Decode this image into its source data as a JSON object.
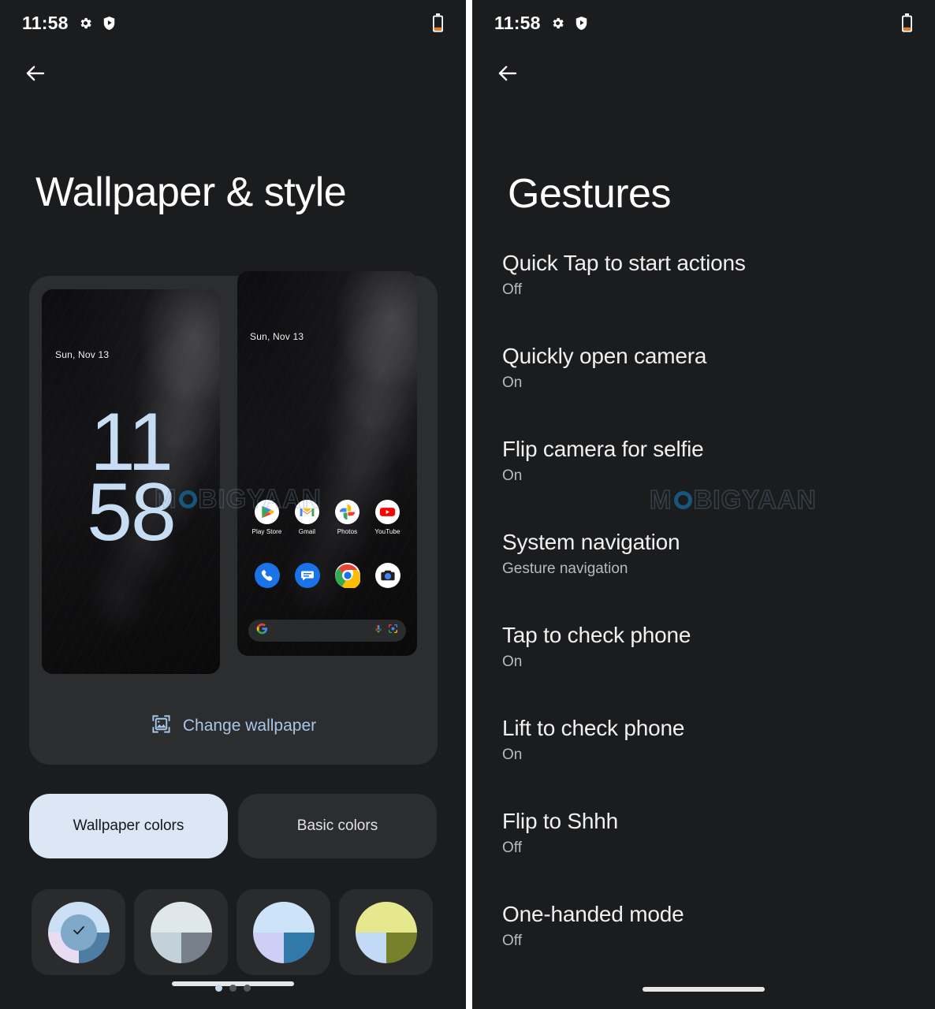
{
  "left_screen": {
    "status_bar": {
      "time": "11:58",
      "icons": [
        "gear-icon",
        "shield-play-icon"
      ],
      "battery": "battery-low-icon"
    },
    "back_label": "back-arrow",
    "title": "Wallpaper & style",
    "preview_card": {
      "lock_preview": {
        "date": "Sun, Nov 13",
        "clock_hours": "11",
        "clock_minutes": "58"
      },
      "home_preview": {
        "date": "Sun, Nov 13",
        "apps": [
          {
            "name": "Play Store",
            "icon": "play-store-icon"
          },
          {
            "name": "Gmail",
            "icon": "gmail-icon"
          },
          {
            "name": "Photos",
            "icon": "google-photos-icon"
          },
          {
            "name": "YouTube",
            "icon": "youtube-icon"
          }
        ],
        "dock": [
          {
            "name": "Phone",
            "icon": "phone-icon"
          },
          {
            "name": "Messages",
            "icon": "messages-icon"
          },
          {
            "name": "Chrome",
            "icon": "chrome-icon"
          },
          {
            "name": "Camera",
            "icon": "camera-icon"
          }
        ],
        "search_bar": {
          "logo": "google-g-icon",
          "mic": "microphone-icon",
          "lens": "google-lens-icon"
        }
      }
    },
    "change_wallpaper": {
      "icon": "image-picture-icon",
      "label": "Change wallpaper",
      "color": "#a8c7e8"
    },
    "tabs": [
      {
        "label": "Wallpaper colors",
        "selected": true
      },
      {
        "label": "Basic colors",
        "selected": false
      }
    ],
    "color_chips": [
      {
        "name": "chip-1",
        "selected": true,
        "top": "#cce0f5",
        "bottom_left": "#e9dbf2",
        "bottom_right": "#4d7da3",
        "center": "#80a9c9",
        "check": "check-icon"
      },
      {
        "name": "chip-2",
        "selected": false,
        "top": "#e0e7eb",
        "bottom_left": "#c3d1d9",
        "bottom_right": "#77808a",
        "center": null,
        "check": null
      },
      {
        "name": "chip-3",
        "selected": false,
        "top": "#cde4f8",
        "bottom_left": "#cdd0f4",
        "bottom_right": "#3079a8",
        "center": null,
        "check": null
      },
      {
        "name": "chip-4",
        "selected": false,
        "top": "#e6e88e",
        "bottom_left": "#c3daf6",
        "bottom_right": "#77802b",
        "center": null,
        "check": null
      }
    ],
    "nav": {
      "home_bar": true,
      "page_dots": 3,
      "active_dot": 0
    },
    "watermark": {
      "prefix": "M",
      "suffix": "BIGYAAN"
    }
  },
  "right_screen": {
    "status_bar": {
      "time": "11:58",
      "icons": [
        "gear-icon",
        "shield-play-icon"
      ],
      "battery": "battery-low-icon"
    },
    "back_label": "back-arrow",
    "title": "Gestures",
    "items": [
      {
        "title": "Quick Tap to start actions",
        "value": "Off"
      },
      {
        "title": "Quickly open camera",
        "value": "On"
      },
      {
        "title": "Flip camera for selfie",
        "value": "On"
      },
      {
        "title": "System navigation",
        "value": "Gesture navigation"
      },
      {
        "title": "Tap to check phone",
        "value": "On"
      },
      {
        "title": "Lift to check phone",
        "value": "On"
      },
      {
        "title": "Flip to Shhh",
        "value": "Off"
      },
      {
        "title": "One-handed mode",
        "value": "Off"
      }
    ],
    "nav": {
      "home_bar": true
    },
    "watermark": {
      "prefix": "M",
      "suffix": "BIGYAAN"
    }
  },
  "colors": {
    "background": "#1b1c1e",
    "card": "#2b2d2f",
    "accent": "#a8c7e8",
    "clock": "#c7ddf4",
    "selected_tab_bg": "#dbe7f5",
    "divider": "#ffffff"
  }
}
